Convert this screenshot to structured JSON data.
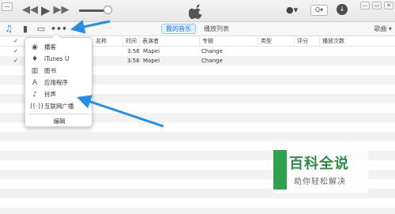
{
  "titlebar": {
    "window_menu_glyph": "—",
    "transport": {
      "prev_glyph": "◀◀",
      "play_glyph": "▶",
      "next_glyph": "▶▶"
    },
    "user_glyph": "●▾",
    "search_glyph": "Q▾",
    "download_glyph": "↓",
    "window_controls": [
      "—",
      "▭",
      "✕"
    ]
  },
  "nav": {
    "tabs": [
      {
        "label": "我的音乐",
        "active": true
      },
      {
        "label": "播放列表",
        "active": false
      }
    ],
    "view_menu": "歌曲 ▾",
    "media_icons": [
      "music-note-icon",
      "movie-icon",
      "tv-icon",
      "more-icon"
    ]
  },
  "table": {
    "headers": {
      "check": "✓",
      "name": "名称",
      "time": "时间",
      "artist": "表演者",
      "album": "专辑",
      "genre": "类型",
      "rating": "评分",
      "plays": "播放次数"
    },
    "rows": [
      {
        "time": "3:56",
        "artist": "Mapei",
        "album": "Change"
      },
      {
        "time": "3:56",
        "artist": "Mapei",
        "album": "Change"
      }
    ]
  },
  "popup_menu": {
    "items": [
      {
        "label": "播客",
        "icon": "podcast-icon"
      },
      {
        "label": "iTunes U",
        "icon": "graduation-cap-icon"
      },
      {
        "label": "图书",
        "icon": "book-icon"
      },
      {
        "label": "应用程序",
        "icon": "app-store-icon"
      },
      {
        "label": "铃声",
        "icon": "bell-icon"
      },
      {
        "label": "互联网广播",
        "icon": "radio-icon"
      }
    ],
    "edit_label": "编辑"
  },
  "watermark": {
    "title": "百科全说",
    "subtitle": "助你轻松解决"
  },
  "colors": {
    "accent": "#1a82f6",
    "arrow": "#2a8de0",
    "watermark_green": "#2f8a47"
  }
}
